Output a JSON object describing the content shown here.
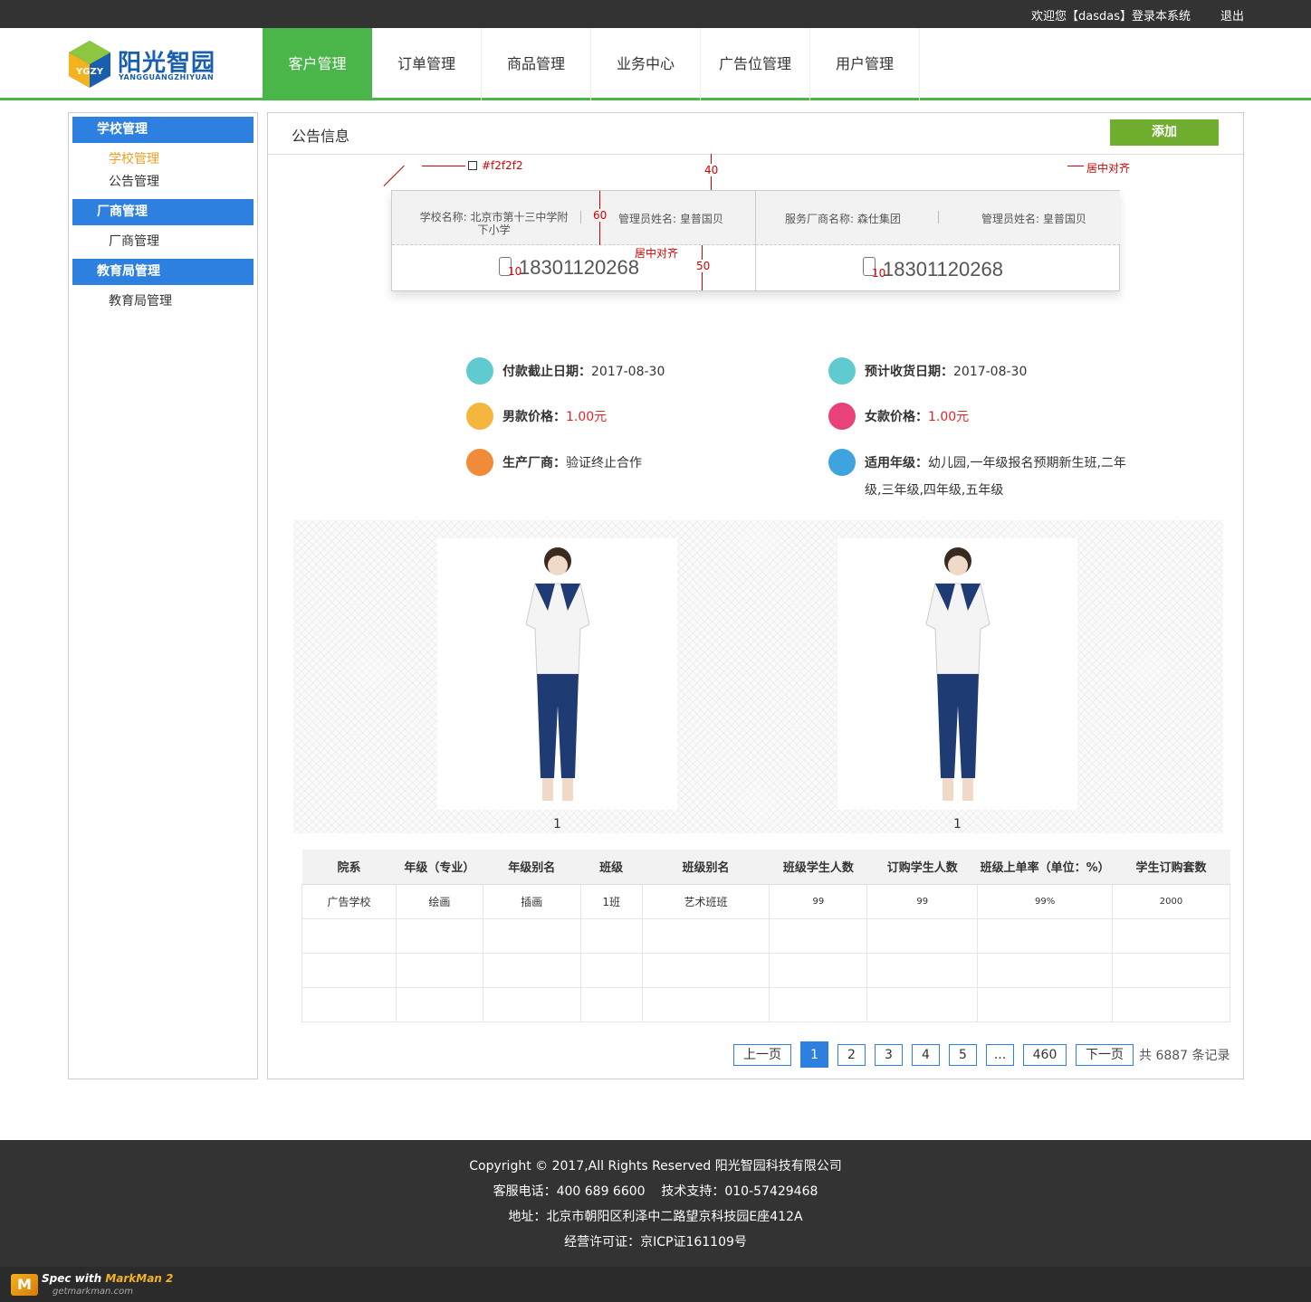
{
  "topbar": {
    "welcome": "欢迎您【dasdas】登录本系统",
    "logout": "退出"
  },
  "logo": {
    "brand": "阳光智园",
    "sub": "YANGGUANGZHIYUAN",
    "badge": "YGZY"
  },
  "nav": [
    "客户管理",
    "订单管理",
    "商品管理",
    "业务中心",
    "广告位管理",
    "用户管理"
  ],
  "sidebar": {
    "groups": [
      {
        "title": "学校管理",
        "items": [
          "学校管理",
          "公告管理"
        ]
      },
      {
        "title": "厂商管理",
        "items": [
          "厂商管理"
        ]
      },
      {
        "title": "教育局管理",
        "items": [
          "教育局管理"
        ]
      }
    ]
  },
  "main": {
    "title": "公告信息",
    "add": "添加"
  },
  "annotations": {
    "color_note": "#f2f2f2",
    "center": "居中对齐",
    "h40": "40",
    "h60": "60",
    "h50": "50",
    "w10": "10"
  },
  "card": {
    "left": {
      "school": "学校名称: 北京市第十三中学附下小学",
      "admin": "管理员姓名: 皇普国贝",
      "phone": "18301120268"
    },
    "right": {
      "vendor": "服务厂商名称: 森仕集团",
      "admin": "管理员姓名: 皇普国贝",
      "phone": "18301120268"
    }
  },
  "info": {
    "pay_label": "付款截止日期：",
    "pay_value": "2017-08-30",
    "receive_label": "预计收货日期：",
    "receive_value": "2017-08-30",
    "male_label": "男款价格：",
    "male_value": "1.00元",
    "female_label": "女款价格：",
    "female_value": "1.00元",
    "maker_label": "生产厂商：",
    "maker_value": "验证终止合作",
    "grade_label": "适用年级：",
    "grade_value1": "幼儿园,一年级报名预期新生班,二年",
    "grade_value2": "级,三年级,四年级,五年级"
  },
  "photos": [
    "1",
    "1"
  ],
  "table": {
    "headers": [
      "院系",
      "年级（专业）",
      "年级别名",
      "班级",
      "班级别名",
      "班级学生人数",
      "订购学生人数",
      "班级上单率（单位：%）",
      "学生订购套数"
    ],
    "rows": [
      [
        "广告学校",
        "绘画",
        "插画",
        "1班",
        "艺术班班",
        "99",
        "99",
        "99%",
        "2000"
      ],
      [
        "",
        "",
        "",
        "",
        "",
        "",
        "",
        "",
        ""
      ],
      [
        "",
        "",
        "",
        "",
        "",
        "",
        "",
        "",
        ""
      ],
      [
        "",
        "",
        "",
        "",
        "",
        "",
        "",
        "",
        ""
      ]
    ]
  },
  "pager": {
    "prev": "上一页",
    "pages": [
      "1",
      "2",
      "3",
      "4",
      "5",
      "...",
      "460"
    ],
    "next": "下一页",
    "total": "共 6887 条记录"
  },
  "footer": {
    "l1": "Copyright © 2017,All Rights Reserved 阳光智园科技有限公司",
    "l2": "客服电话：400 689 6600    技术支持：010-57429468",
    "l3": "地址：北京市朝阳区利泽中二路望京科技园E座412A",
    "l4": "经营许可证：京ICP证161109号"
  },
  "markman": {
    "text1": "Spec with ",
    "text2": "MarkMan 2",
    "url": "getmarkman.com"
  },
  "colors": {
    "green": "#4ab549",
    "blue": "#2d7fe0",
    "red": "#e0262a",
    "dark": "#333333"
  }
}
